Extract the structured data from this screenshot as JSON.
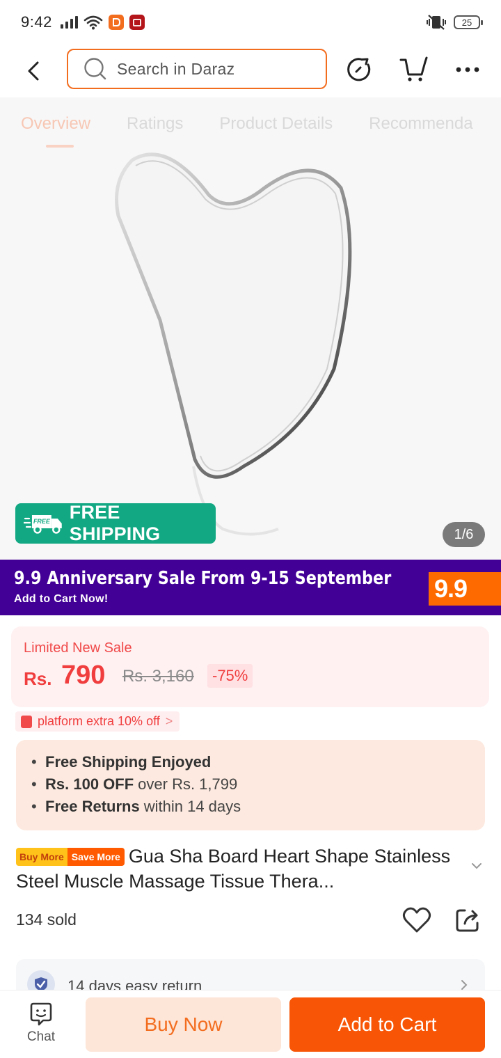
{
  "status_bar": {
    "time": "9:42",
    "battery": "25"
  },
  "header": {
    "search_placeholder": "Search in Daraz",
    "icons": [
      "back-arrow-icon",
      "search-icon",
      "history-icon",
      "cart-icon",
      "more-icon"
    ]
  },
  "tabs": [
    {
      "label": "Overview",
      "active": true
    },
    {
      "label": "Ratings",
      "active": false
    },
    {
      "label": "Product Details",
      "active": false
    },
    {
      "label": "Recommenda",
      "active": false
    }
  ],
  "gallery": {
    "free_shipping_badge": "FREE SHIPPING",
    "free_shipping_icon_text": "FREE",
    "image_counter": "1/6"
  },
  "banner": {
    "title": "9.9 Anniversary Sale From 9-15 September",
    "subtitle": "Add to Cart Now!",
    "badge": "9.9"
  },
  "price": {
    "label": "Limited New Sale",
    "currency": "Rs.",
    "current": "790",
    "original": "Rs. 3,160",
    "discount": "-75%"
  },
  "voucher": {
    "label": "platform extra 10% off",
    "chevron": ">"
  },
  "perks": [
    {
      "bold": "Free Shipping Enjoyed",
      "rest": ""
    },
    {
      "bold": "Rs. 100 OFF",
      "rest": "over Rs. 1,799"
    },
    {
      "bold": "Free Returns",
      "rest": "within 14 days"
    }
  ],
  "product": {
    "tag_left": "Buy More",
    "tag_right": "Save More",
    "title": "Gua Sha Board Heart Shape Stainless Steel Muscle Massage Tissue Thera...",
    "sold": "134 sold"
  },
  "return_policy": {
    "label": "14 days easy return"
  },
  "bottom_bar": {
    "chat_label": "Chat",
    "buy_now": "Buy Now",
    "add_to_cart": "Add to Cart"
  },
  "colors": {
    "brand_orange": "#f85606",
    "free_shipping_green": "#12a883",
    "banner_purple": "#430097",
    "price_red": "#f03d3d"
  }
}
